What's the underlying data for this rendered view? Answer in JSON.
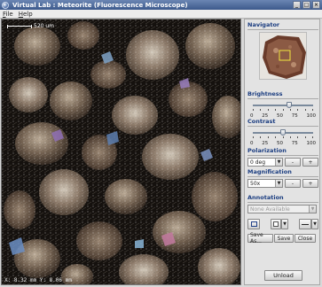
{
  "window": {
    "title": "Virtual Lab : Meteorite (Fluorescence Microscope)",
    "controls": [
      "_",
      "□",
      "×"
    ]
  },
  "menu": [
    {
      "label": "File"
    },
    {
      "label": "Help"
    }
  ],
  "viewer": {
    "scale_label": "520 um",
    "coords": "X: 8.32 mm Y: 8.06 mm"
  },
  "panel": {
    "navigator": {
      "title": "Navigator"
    },
    "brightness": {
      "title": "Brightness",
      "value": 60,
      "ticks": [
        "0",
        "25",
        "50",
        "75",
        "100"
      ]
    },
    "contrast": {
      "title": "Contrast",
      "value": 50,
      "ticks": [
        "0",
        "25",
        "50",
        "75",
        "100"
      ]
    },
    "polarization": {
      "title": "Polarization",
      "value": "0 deg",
      "minus": "-",
      "plus": "+"
    },
    "magnification": {
      "title": "Magnification",
      "value": "50x",
      "minus": "-",
      "plus": "+"
    },
    "annotation": {
      "title": "Annotation",
      "select_placeholder": "None Available",
      "save_as": "Save As...",
      "save": "Save",
      "close": "Close"
    },
    "unload": "Unload"
  },
  "colors": {
    "title_bar": "#3d5a8c",
    "group_title": "#1b3d80",
    "viewer_bg": "#15110e"
  },
  "icons": [
    "app-icon",
    "rectangle-tool-icon",
    "color-picker-icon",
    "line-style-icon"
  ]
}
